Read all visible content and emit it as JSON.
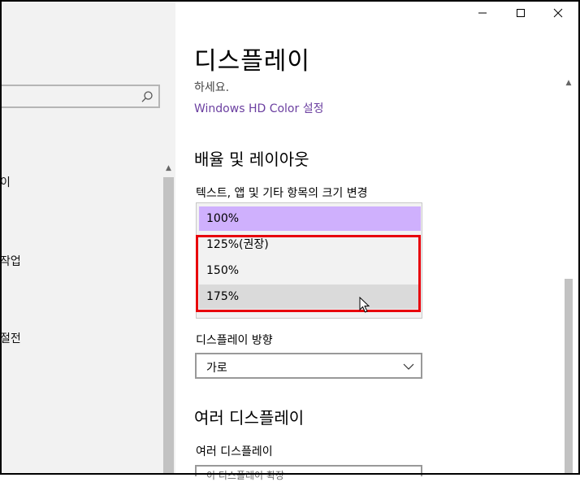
{
  "window": {
    "minimize": "—",
    "maximize": "☐",
    "close": "✕"
  },
  "left_nav": {
    "search_placeholder": "",
    "items": [
      "이",
      "작업",
      "절전"
    ]
  },
  "page": {
    "title": "디스플레이",
    "clipped_text": "하세요.",
    "hdr_link": "Windows HD Color 설정"
  },
  "scale_section": {
    "heading": "배율 및 레이아웃",
    "label": "텍스트, 앱 및 기타 항목의 크기 변경",
    "options": [
      "100%",
      "125%(권장)",
      "150%",
      "175%"
    ],
    "selected": "100%",
    "hovered": "175%"
  },
  "orientation": {
    "label": "디스플레이 방향",
    "value": "가로"
  },
  "multi_display": {
    "heading": "여러 디스플레이",
    "label": "여러 디스플레이",
    "value": "이 디스플레이 확장"
  },
  "colors": {
    "selected_option": "#cfb0fd",
    "link": "#6b3fa0",
    "highlight": "#e8000b"
  }
}
